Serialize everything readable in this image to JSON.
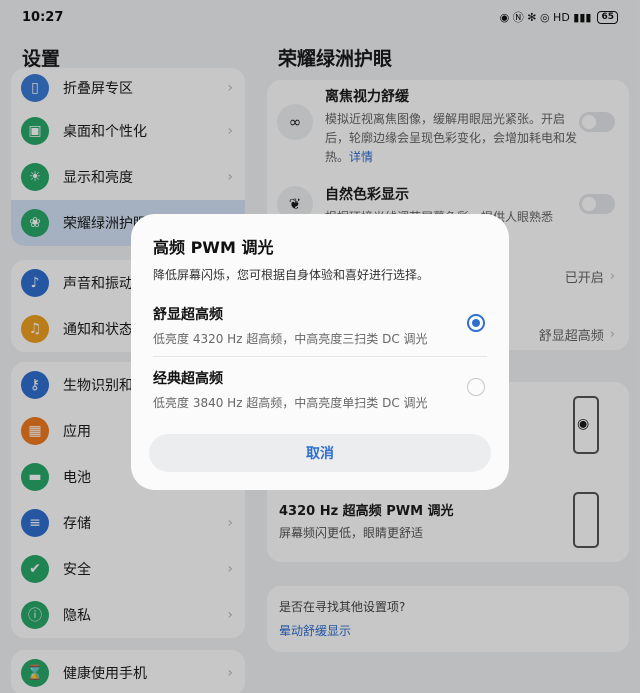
{
  "status": {
    "time": "10:27",
    "icons": "◉ Ⓝ ✻ ◎ HD ▮▮▮",
    "battery": "65"
  },
  "left": {
    "title": "设置",
    "items": [
      {
        "label": "折叠屏专区",
        "icon": "foldable-icon",
        "color": "#3a7bd5"
      },
      {
        "label": "桌面和个性化",
        "icon": "wallpaper-icon",
        "color": "#2aa86a"
      },
      {
        "label": "显示和亮度",
        "icon": "brightness-icon",
        "color": "#2aa86a"
      },
      {
        "label": "荣耀绿洲护眼",
        "icon": "eye-care-icon",
        "color": "#2aa86a"
      },
      {
        "label": "声音和振动",
        "icon": "sound-icon",
        "color": "#2f6fd0"
      },
      {
        "label": "通知和状态",
        "icon": "bell-icon",
        "color": "#f0a020"
      },
      {
        "label": "生物识别和",
        "icon": "key-icon",
        "color": "#2f6fd0"
      },
      {
        "label": "应用",
        "icon": "apps-icon",
        "color": "#f07a20"
      },
      {
        "label": "电池",
        "icon": "battery-icon",
        "color": "#2aa86a"
      },
      {
        "label": "存储",
        "icon": "storage-icon",
        "color": "#2f6fd0"
      },
      {
        "label": "安全",
        "icon": "shield-icon",
        "color": "#2aa86a"
      },
      {
        "label": "隐私",
        "icon": "privacy-icon",
        "color": "#2aa86a"
      },
      {
        "label": "健康使用手机",
        "icon": "hourglass-icon",
        "color": "#2aa86a"
      }
    ]
  },
  "right": {
    "title": "荣耀绿洲护眼",
    "feature1": {
      "title": "离焦视力舒缓",
      "desc": "模拟近视离焦图像，缓解用眼屈光紧张。开启后，轮廓边缘会呈现色彩变化，会增加耗电和发热。",
      "link": "详情"
    },
    "feature2": {
      "title": "自然色彩显示",
      "desc": "根据环境光线调节屏幕色彩，提供人眼熟悉"
    },
    "row1_value": "已开启",
    "row2_value": "舒显超高频",
    "pwm_title": "4320 Hz 超高频 PWM 调光",
    "pwm_desc": "屏幕频闪更低，眼睛更舒适",
    "search_prompt": "是否在寻找其他设置项?",
    "search_link": "晕动舒缓显示"
  },
  "dialog": {
    "title": "高频 PWM 调光",
    "subtitle": "降低屏幕闪烁，您可根据自身体验和喜好进行选择。",
    "options": [
      {
        "title": "舒显超高频",
        "desc": "低亮度 4320 Hz 超高频，中高亮度三扫类 DC 调光",
        "selected": true
      },
      {
        "title": "经典超高频",
        "desc": "低亮度 3840 Hz 超高频，中高亮度单扫类 DC 调光",
        "selected": false
      }
    ],
    "cancel": "取消"
  },
  "colors": {
    "accent": "#2f6fd0",
    "active_bg": "#d4e3f7"
  }
}
